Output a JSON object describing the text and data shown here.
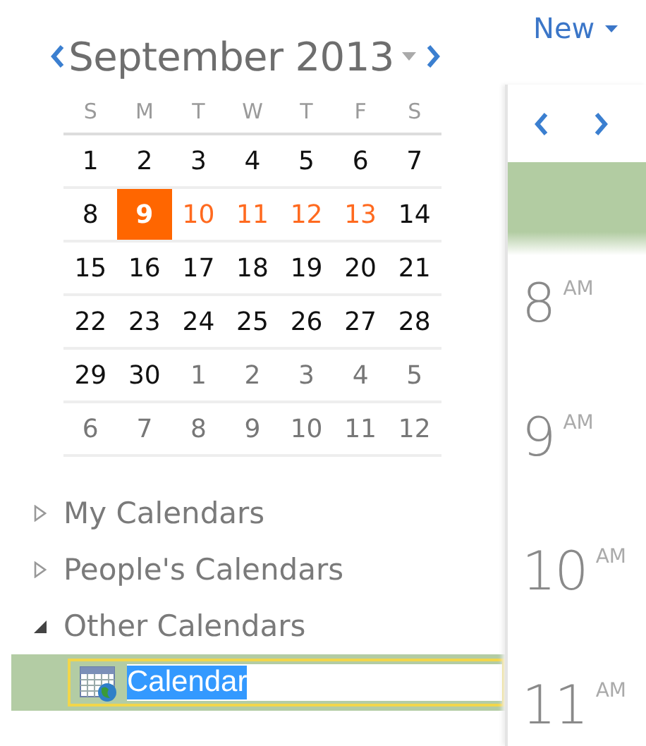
{
  "mini_calendar": {
    "title": "September 2013",
    "weekdays": [
      "S",
      "M",
      "T",
      "W",
      "T",
      "F",
      "S"
    ],
    "weeks": [
      [
        {
          "day": "1",
          "kind": "normal"
        },
        {
          "day": "2",
          "kind": "normal"
        },
        {
          "day": "3",
          "kind": "normal"
        },
        {
          "day": "4",
          "kind": "normal"
        },
        {
          "day": "5",
          "kind": "normal"
        },
        {
          "day": "6",
          "kind": "normal"
        },
        {
          "day": "7",
          "kind": "normal"
        }
      ],
      [
        {
          "day": "8",
          "kind": "normal"
        },
        {
          "day": "9",
          "kind": "today"
        },
        {
          "day": "10",
          "kind": "marked"
        },
        {
          "day": "11",
          "kind": "marked"
        },
        {
          "day": "12",
          "kind": "marked"
        },
        {
          "day": "13",
          "kind": "marked"
        },
        {
          "day": "14",
          "kind": "normal"
        }
      ],
      [
        {
          "day": "15",
          "kind": "normal"
        },
        {
          "day": "16",
          "kind": "normal"
        },
        {
          "day": "17",
          "kind": "normal"
        },
        {
          "day": "18",
          "kind": "normal"
        },
        {
          "day": "19",
          "kind": "normal"
        },
        {
          "day": "20",
          "kind": "normal"
        },
        {
          "day": "21",
          "kind": "normal"
        }
      ],
      [
        {
          "day": "22",
          "kind": "normal"
        },
        {
          "day": "23",
          "kind": "normal"
        },
        {
          "day": "24",
          "kind": "normal"
        },
        {
          "day": "25",
          "kind": "normal"
        },
        {
          "day": "26",
          "kind": "normal"
        },
        {
          "day": "27",
          "kind": "normal"
        },
        {
          "day": "28",
          "kind": "normal"
        }
      ],
      [
        {
          "day": "29",
          "kind": "normal"
        },
        {
          "day": "30",
          "kind": "normal"
        },
        {
          "day": "1",
          "kind": "other"
        },
        {
          "day": "2",
          "kind": "other"
        },
        {
          "day": "3",
          "kind": "other"
        },
        {
          "day": "4",
          "kind": "other"
        },
        {
          "day": "5",
          "kind": "other"
        }
      ],
      [
        {
          "day": "6",
          "kind": "other"
        },
        {
          "day": "7",
          "kind": "other"
        },
        {
          "day": "8",
          "kind": "other"
        },
        {
          "day": "9",
          "kind": "other"
        },
        {
          "day": "10",
          "kind": "other"
        },
        {
          "day": "11",
          "kind": "other"
        },
        {
          "day": "12",
          "kind": "other"
        }
      ]
    ]
  },
  "calendar_tree": [
    {
      "label": "My Calendars",
      "expanded": false
    },
    {
      "label": "People's Calendars",
      "expanded": false
    },
    {
      "label": "Other Calendars",
      "expanded": true,
      "children": [
        {
          "label": "Calendar",
          "selected": true,
          "editing": true
        }
      ]
    }
  ],
  "day_view": {
    "new_button": "New",
    "hours": [
      {
        "hour": "8",
        "period": "AM"
      },
      {
        "hour": "9",
        "period": "AM"
      },
      {
        "hour": "10",
        "period": "AM"
      },
      {
        "hour": "11",
        "period": "AM"
      }
    ]
  }
}
